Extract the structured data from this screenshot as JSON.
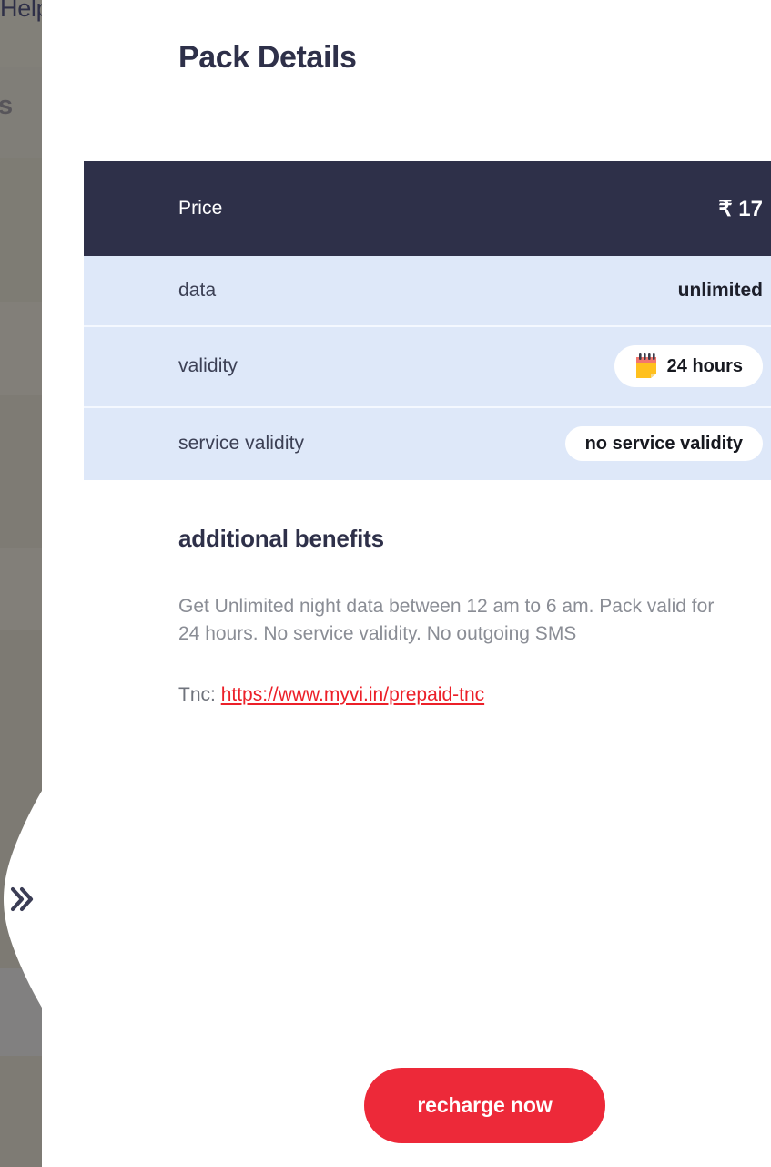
{
  "overlay": {
    "behind_fragments": [
      "Help",
      "s"
    ],
    "backdrop_color": "#807d77"
  },
  "drawer": {
    "collapse_tab_icon": "double-chevron-right-icon",
    "collapse_tab_label": "»"
  },
  "header": {
    "title": "Pack Details"
  },
  "details_table": {
    "rows": [
      {
        "label": "Price",
        "value": "₹ 17",
        "style": "dark",
        "chip": false
      },
      {
        "label": "data",
        "value": "unlimited",
        "style": "light",
        "chip": false
      },
      {
        "label": "validity",
        "value": "24 hours",
        "style": "light",
        "chip": true,
        "icon": "spiral-notepad-icon"
      },
      {
        "label": "service validity",
        "value": "no service validity",
        "style": "light",
        "chip": true,
        "icon": null
      }
    ]
  },
  "benefits": {
    "title": "additional benefits",
    "description": "Get Unlimited night data between 12 am to 6 am. Pack valid for 24 hours. No service validity. No outgoing SMS",
    "tnc_label": "Tnc:",
    "tnc_link_text": "https://www.myvi.in/prepaid-tnc"
  },
  "cta": {
    "recharge_label": "recharge now"
  },
  "colors": {
    "price_row_bg": "#2e3049",
    "data_row_bg": "#dee8f9",
    "accent_red": "#ed2939",
    "heading": "#2e3049",
    "muted_text": "#8a8d95"
  }
}
